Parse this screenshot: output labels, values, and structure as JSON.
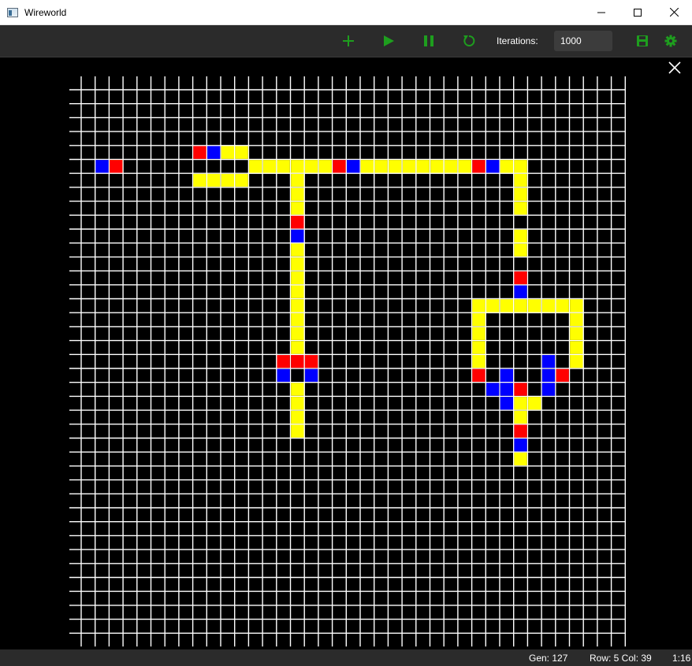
{
  "window": {
    "title": "Wireworld"
  },
  "toolbar": {
    "iterations_label": "Iterations:",
    "iterations_value": "1000",
    "icons": [
      "plus-icon",
      "play-icon",
      "pause-icon",
      "reset-icon",
      "save-icon",
      "gear-icon"
    ],
    "accent": "#1e9e1e"
  },
  "status": {
    "generation": "Gen: 127",
    "position": "Row: 5 Col: 39",
    "zoom": "1:16"
  },
  "grid": {
    "rows": 39,
    "cols": 39,
    "colors": {
      "background": "#000000",
      "gridline": "#ffffff",
      "conductor": "#ffff00",
      "head": "#0000ff",
      "tail": "#ff0000"
    },
    "cells": {
      "conductor": [
        [
          4,
          10
        ],
        [
          4,
          11
        ],
        [
          5,
          2
        ],
        [
          5,
          12
        ],
        [
          5,
          13
        ],
        [
          5,
          14
        ],
        [
          5,
          15
        ],
        [
          5,
          16
        ],
        [
          5,
          17
        ],
        [
          5,
          20
        ],
        [
          5,
          21
        ],
        [
          5,
          22
        ],
        [
          5,
          23
        ],
        [
          5,
          24
        ],
        [
          5,
          25
        ],
        [
          5,
          26
        ],
        [
          5,
          27
        ],
        [
          5,
          30
        ],
        [
          5,
          31
        ],
        [
          6,
          8
        ],
        [
          6,
          9
        ],
        [
          6,
          10
        ],
        [
          6,
          11
        ],
        [
          6,
          15
        ],
        [
          6,
          31
        ],
        [
          7,
          15
        ],
        [
          7,
          31
        ],
        [
          8,
          15
        ],
        [
          8,
          31
        ],
        [
          10,
          15
        ],
        [
          10,
          31
        ],
        [
          11,
          15
        ],
        [
          11,
          31
        ],
        [
          12,
          15
        ],
        [
          13,
          15
        ],
        [
          14,
          15
        ],
        [
          14,
          31
        ],
        [
          15,
          15
        ],
        [
          15,
          28
        ],
        [
          15,
          29
        ],
        [
          15,
          30
        ],
        [
          15,
          31
        ],
        [
          15,
          32
        ],
        [
          15,
          33
        ],
        [
          15,
          34
        ],
        [
          15,
          35
        ],
        [
          16,
          15
        ],
        [
          16,
          28
        ],
        [
          16,
          35
        ],
        [
          17,
          15
        ],
        [
          17,
          28
        ],
        [
          17,
          35
        ],
        [
          18,
          15
        ],
        [
          18,
          28
        ],
        [
          18,
          35
        ],
        [
          19,
          28
        ],
        [
          19,
          35
        ],
        [
          20,
          33
        ],
        [
          21,
          15
        ],
        [
          22,
          15
        ],
        [
          22,
          31
        ],
        [
          22,
          32
        ],
        [
          23,
          15
        ],
        [
          23,
          31
        ],
        [
          24,
          15
        ],
        [
          26,
          31
        ]
      ],
      "head": [
        [
          4,
          9
        ],
        [
          5,
          1
        ],
        [
          5,
          19
        ],
        [
          5,
          29
        ],
        [
          10,
          15
        ],
        [
          14,
          31
        ],
        [
          20,
          14
        ],
        [
          20,
          16
        ],
        [
          20,
          30
        ],
        [
          20,
          33
        ],
        [
          21,
          29
        ],
        [
          21,
          30
        ],
        [
          21,
          33
        ],
        [
          22,
          30
        ],
        [
          19,
          33
        ],
        [
          25,
          31
        ]
      ],
      "tail": [
        [
          4,
          8
        ],
        [
          5,
          2
        ],
        [
          5,
          18
        ],
        [
          5,
          28
        ],
        [
          9,
          15
        ],
        [
          13,
          31
        ],
        [
          19,
          14
        ],
        [
          19,
          15
        ],
        [
          19,
          16
        ],
        [
          20,
          28
        ],
        [
          20,
          34
        ],
        [
          21,
          31
        ],
        [
          24,
          31
        ]
      ]
    }
  }
}
